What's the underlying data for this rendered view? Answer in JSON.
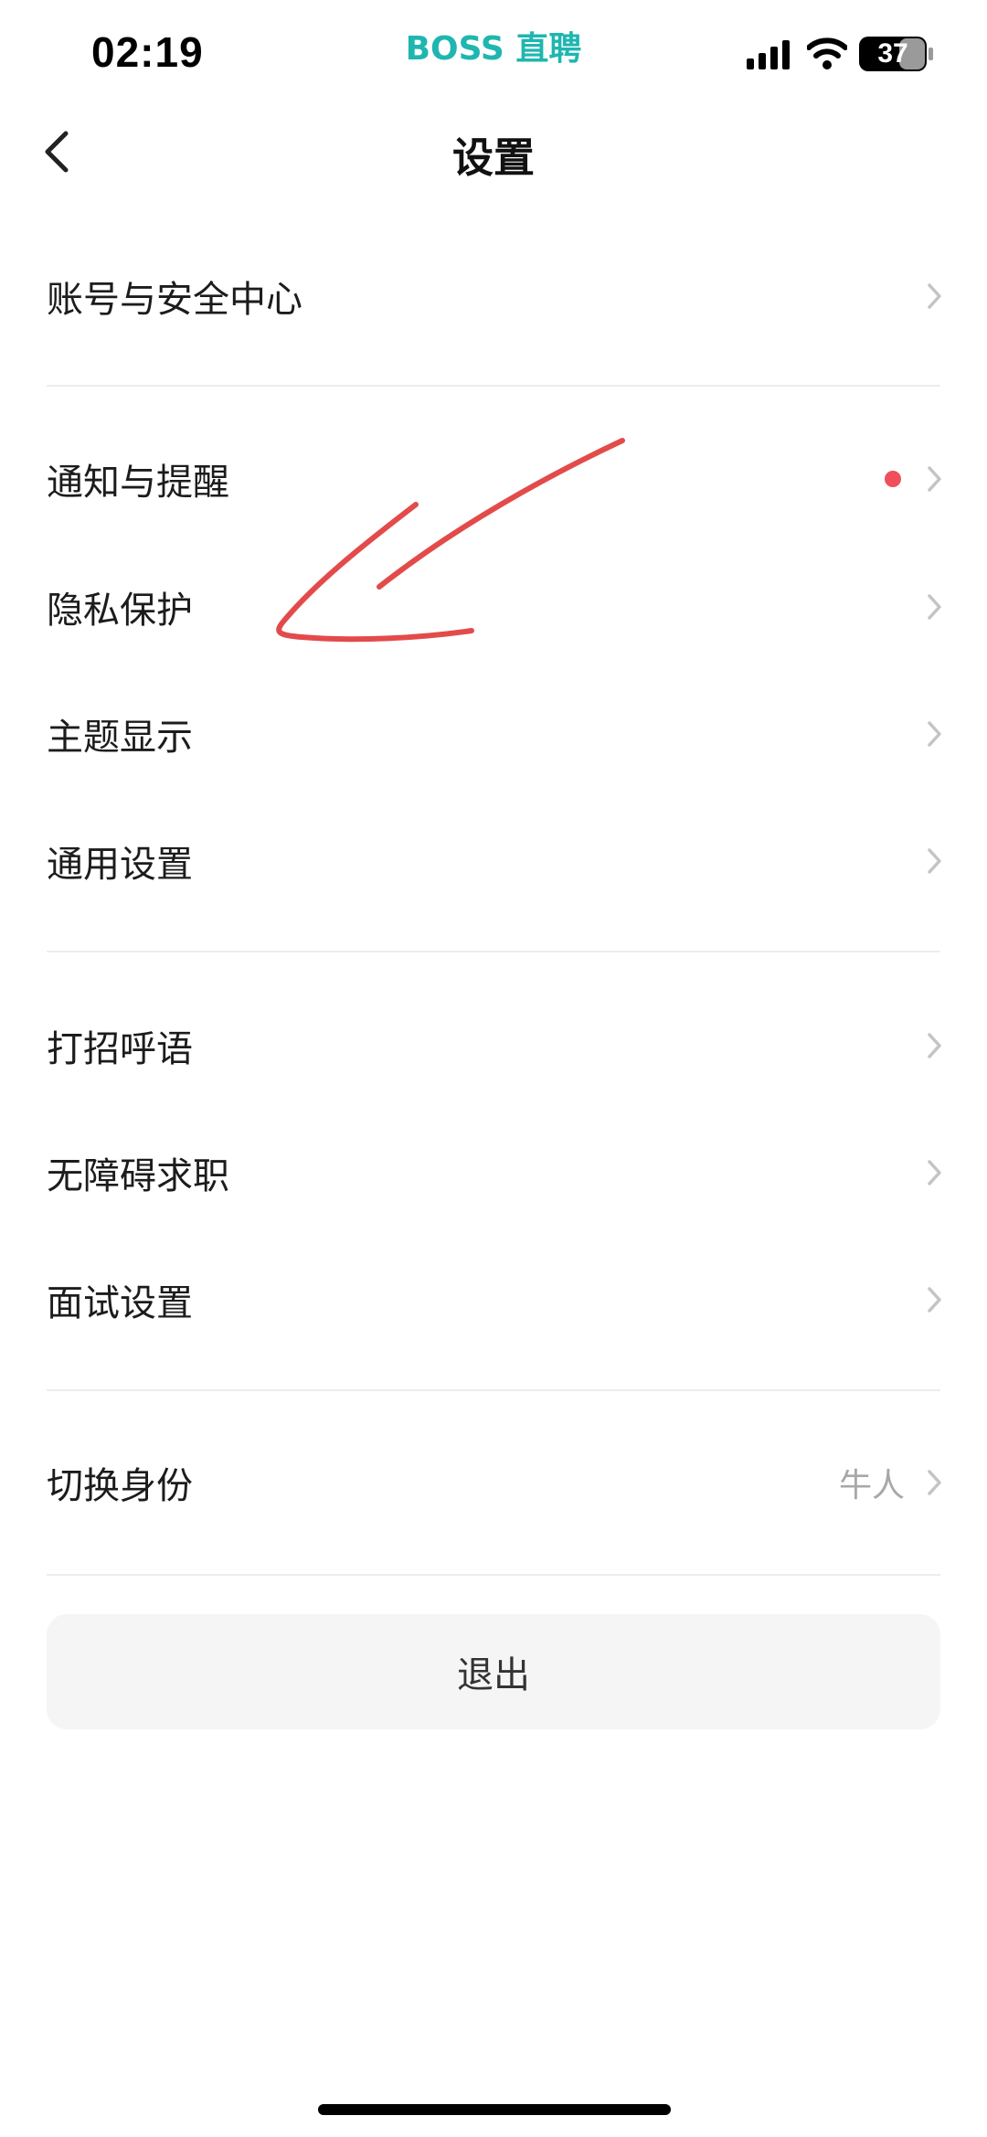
{
  "status_bar": {
    "time": "02:19",
    "app_name_latin": "BOSS",
    "app_name_cjk": "直聘",
    "battery": "37",
    "icons": [
      "signal-icon",
      "wifi-icon",
      "battery-icon"
    ]
  },
  "nav": {
    "title": "设置",
    "back_icon": "chevron-left-icon"
  },
  "settings": {
    "groups": [
      {
        "items": [
          {
            "label": "账号与安全中心"
          }
        ]
      },
      {
        "items": [
          {
            "label": "通知与提醒",
            "badge": "red-dot"
          },
          {
            "label": "隐私保护"
          },
          {
            "label": "主题显示"
          },
          {
            "label": "通用设置"
          }
        ]
      },
      {
        "items": [
          {
            "label": "打招呼语"
          },
          {
            "label": "无障碍求职"
          },
          {
            "label": "面试设置"
          }
        ]
      },
      {
        "items": [
          {
            "label": "切换身份",
            "value": "牛人"
          }
        ]
      }
    ]
  },
  "logout": {
    "label": "退出"
  },
  "colors": {
    "brand": "#1fb6b0",
    "red_dot": "#f04e5b",
    "annotation": "#e34b4b",
    "chevron": "#c4c4c4",
    "divider": "#ededed",
    "button_bg": "#f5f5f5"
  }
}
